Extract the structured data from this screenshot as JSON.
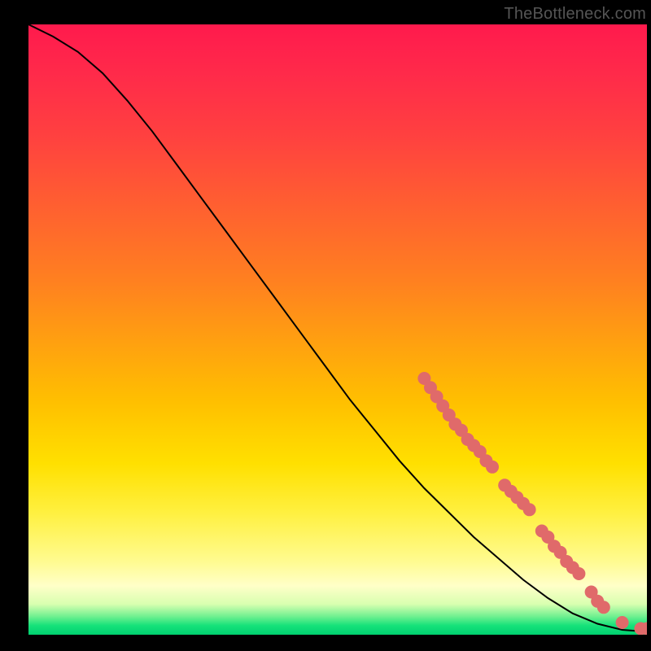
{
  "attribution": "TheBottleneck.com",
  "colors": {
    "marker_fill": "#e06a6a",
    "marker_stroke": "#c85050",
    "curve_stroke": "#000000"
  },
  "chart_data": {
    "type": "line",
    "title": "",
    "xlabel": "",
    "ylabel": "",
    "xlim": [
      0,
      100
    ],
    "ylim": [
      0,
      100
    ],
    "grid": false,
    "legend": false,
    "series": [
      {
        "name": "curve",
        "x": [
          0,
          4,
          8,
          12,
          16,
          20,
          24,
          28,
          32,
          36,
          40,
          44,
          48,
          52,
          56,
          60,
          64,
          68,
          72,
          76,
          80,
          84,
          88,
          92,
          96,
          100
        ],
        "y": [
          100,
          98,
          95.5,
          92,
          87.5,
          82.5,
          77,
          71.5,
          66,
          60.5,
          55,
          49.5,
          44,
          38.5,
          33.5,
          28.5,
          24,
          20,
          16,
          12.5,
          9,
          6,
          3.5,
          1.8,
          0.8,
          0.5
        ]
      }
    ],
    "markers": [
      {
        "cluster": "upper-diagonal",
        "points_xy": [
          [
            64,
            42
          ],
          [
            65,
            40.5
          ],
          [
            66,
            39
          ],
          [
            67,
            37.5
          ],
          [
            68,
            36
          ],
          [
            69,
            34.5
          ],
          [
            70,
            33.5
          ],
          [
            71,
            32
          ],
          [
            72,
            31
          ],
          [
            73,
            30
          ],
          [
            74,
            28.5
          ],
          [
            75,
            27.5
          ]
        ]
      },
      {
        "cluster": "mid-diagonal-gap-then",
        "points_xy": [
          [
            77,
            24.5
          ],
          [
            78,
            23.5
          ],
          [
            79,
            22.5
          ],
          [
            80,
            21.5
          ],
          [
            81,
            20.5
          ]
        ]
      },
      {
        "cluster": "lower-diagonal",
        "points_xy": [
          [
            83,
            17
          ],
          [
            84,
            16
          ],
          [
            85,
            14.5
          ],
          [
            86,
            13.5
          ],
          [
            87,
            12
          ],
          [
            88,
            11
          ],
          [
            89,
            10
          ]
        ]
      },
      {
        "cluster": "near-bottom",
        "points_xy": [
          [
            91,
            7
          ],
          [
            92,
            5.5
          ],
          [
            93,
            4.5
          ]
        ]
      },
      {
        "cluster": "bottom-isolated",
        "points_xy": [
          [
            96,
            2
          ],
          [
            99,
            1
          ],
          [
            100,
            1
          ]
        ]
      }
    ]
  }
}
